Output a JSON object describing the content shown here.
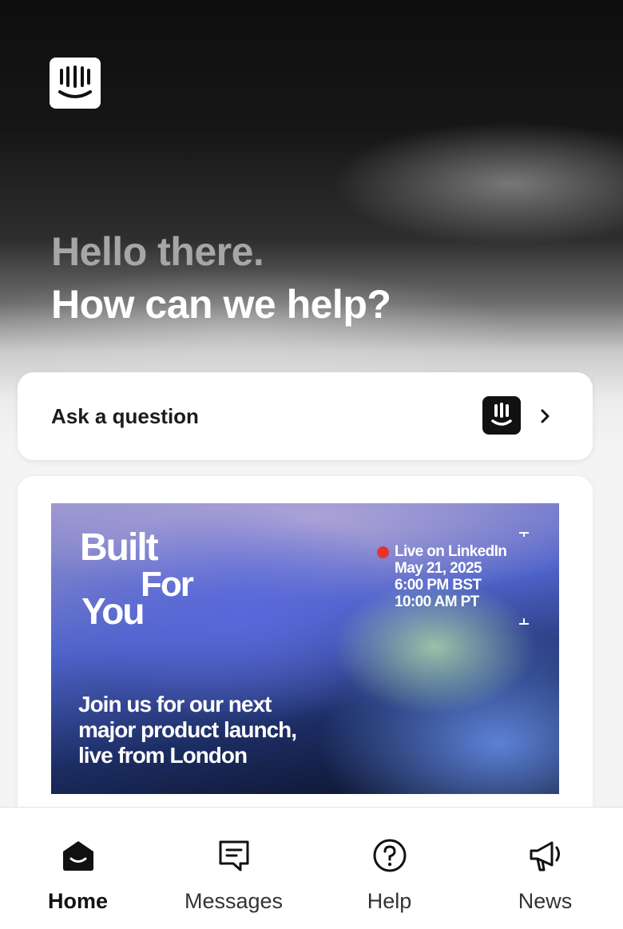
{
  "hero": {
    "greeting": "Hello there.",
    "headline": "How can we help?"
  },
  "ask": {
    "label": "Ask a question",
    "avatar_icon": "intercom-logo-icon",
    "chevron_icon": "chevron-right-icon"
  },
  "news_banner": {
    "title_built": "Built",
    "title_for": "For",
    "title_you": "You",
    "live_text": "Live on LinkedIn",
    "date": "May 21, 2025",
    "time_bst": "6:00 PM BST",
    "time_pt": "10:00 AM PT",
    "promo_line1": "Join us for our next",
    "promo_line2": "major product launch,",
    "promo_line3": "live from London",
    "live_color": "#e8322c"
  },
  "tabs": [
    {
      "label": "Home",
      "icon": "home-icon",
      "active": true
    },
    {
      "label": "Messages",
      "icon": "messages-icon",
      "active": false
    },
    {
      "label": "Help",
      "icon": "help-icon",
      "active": false
    },
    {
      "label": "News",
      "icon": "megaphone-icon",
      "active": false
    }
  ]
}
